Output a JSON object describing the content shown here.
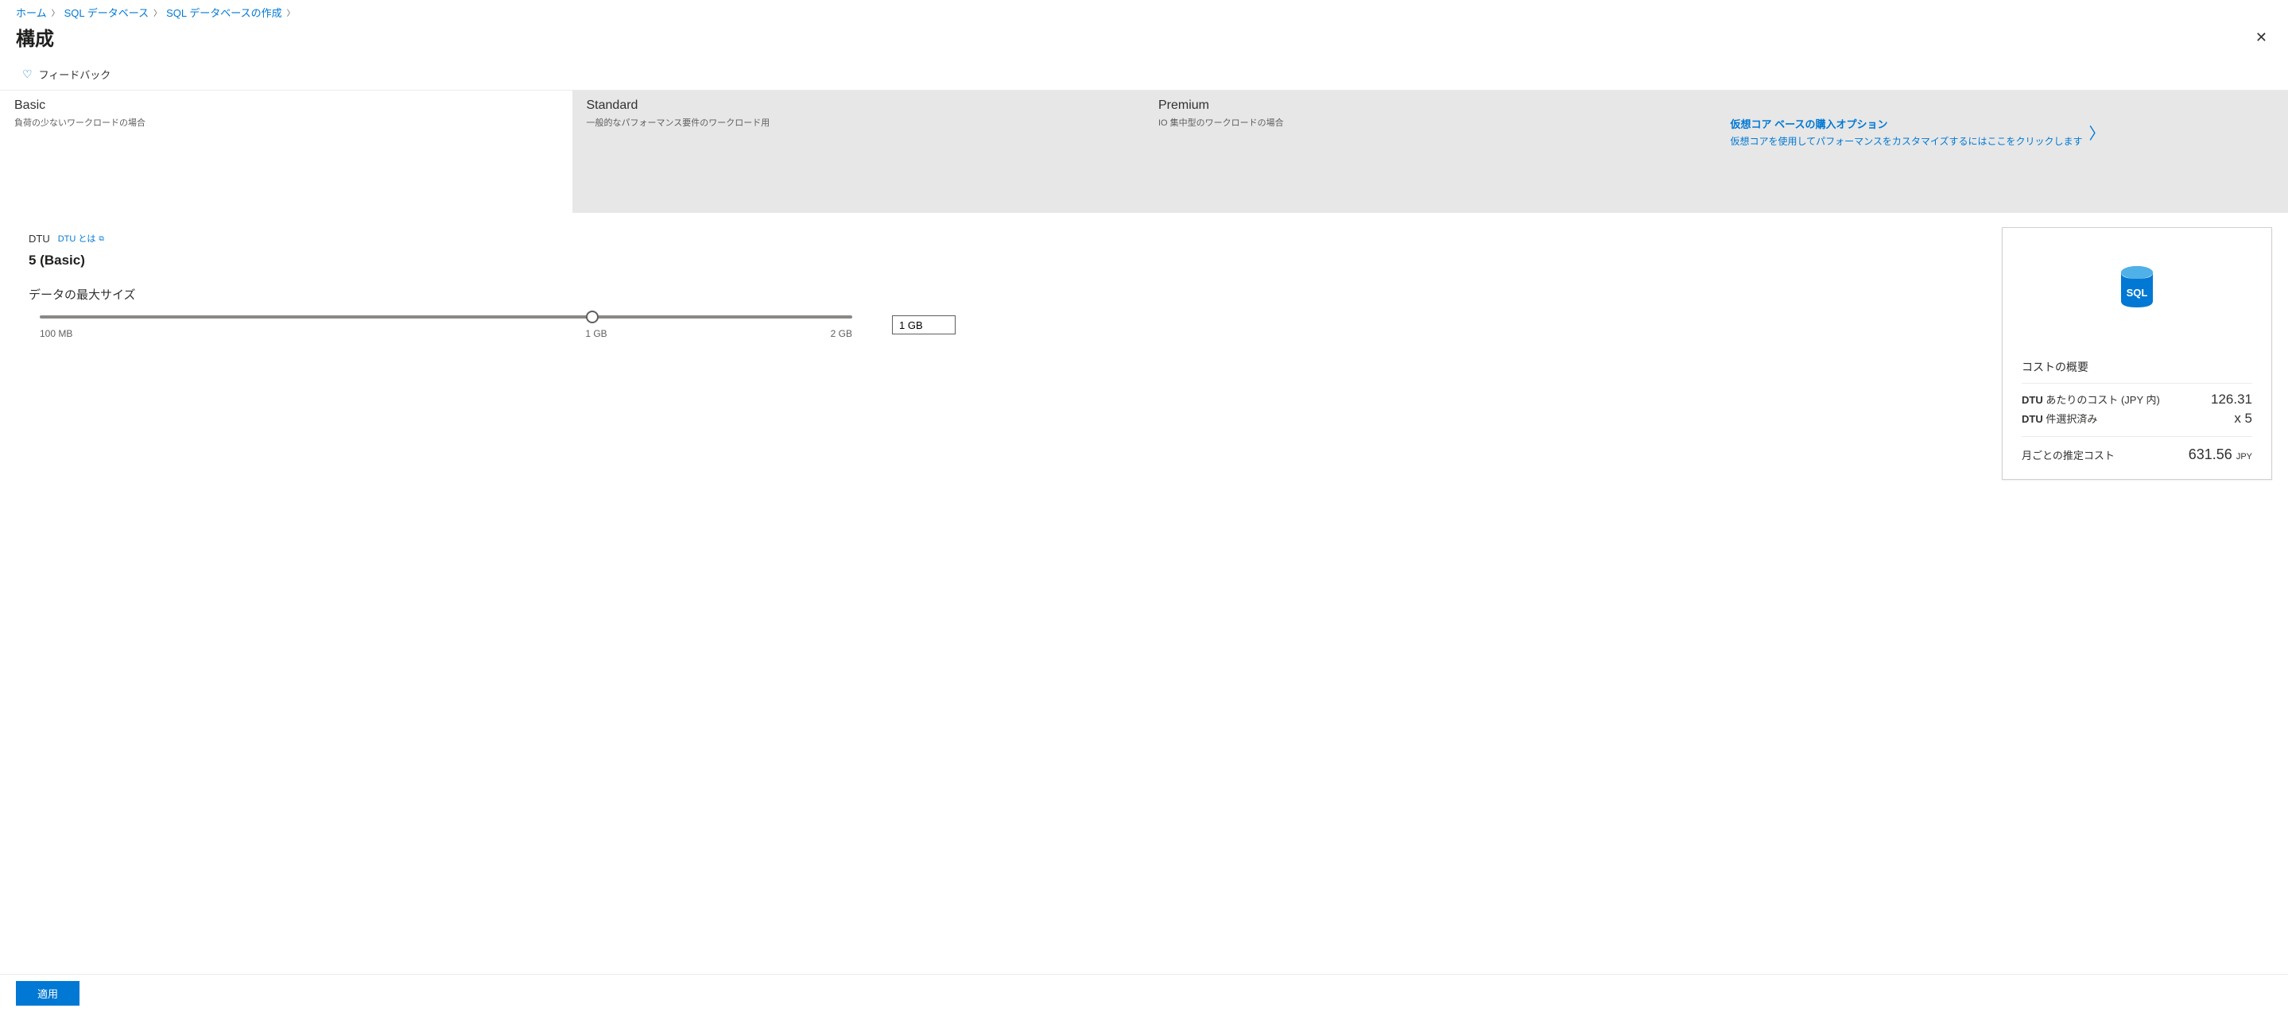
{
  "breadcrumb": {
    "home": "ホーム",
    "sql_db": "SQL データベース",
    "create": "SQL データベースの作成"
  },
  "page_title": "構成",
  "feedback": "フィードバック",
  "tiers": {
    "basic": {
      "title": "Basic",
      "desc": "負荷の少ないワークロードの場合"
    },
    "standard": {
      "title": "Standard",
      "desc": "一般的なパフォーマンス要件のワークロード用"
    },
    "premium": {
      "title": "Premium",
      "desc": "IO 集中型のワークロードの場合"
    },
    "vcore": {
      "title": "仮想コア ベースの購入オプション",
      "desc": "仮想コアを使用してパフォーマンスをカスタマイズするにはここをクリックします"
    }
  },
  "dtu": {
    "label": "DTU",
    "link": "DTU とは",
    "value": "5 (Basic)"
  },
  "size": {
    "label": "データの最大サイズ",
    "min": "100 MB",
    "mid": "1 GB",
    "max": "2 GB",
    "input": "1 GB"
  },
  "cost": {
    "summary_title": "コストの概要",
    "per_dtu_label_prefix": "DTU",
    "per_dtu_label_suffix": " あたりのコスト (JPY 内)",
    "per_dtu_value": "126.31",
    "selected_prefix": "DTU",
    "selected_suffix": " 件選択済み",
    "selected_value": "x 5",
    "monthly_label": "月ごとの推定コスト",
    "monthly_value": "631.56",
    "currency": "JPY"
  },
  "footer": {
    "apply": "適用"
  }
}
